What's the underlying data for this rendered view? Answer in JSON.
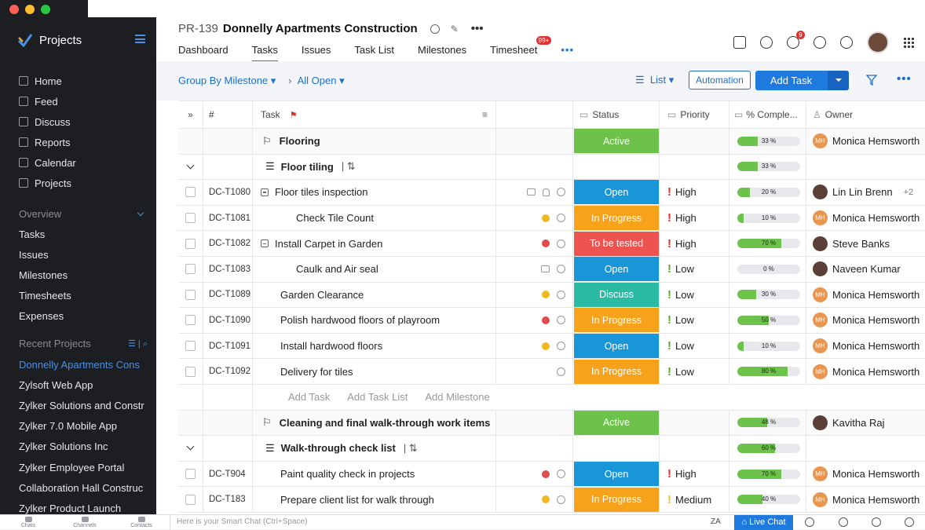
{
  "sidebar": {
    "app_title": "Projects",
    "nav": [
      {
        "label": "Home",
        "icon": "home-icon"
      },
      {
        "label": "Feed",
        "icon": "feed-icon"
      },
      {
        "label": "Discuss",
        "icon": "discuss-icon"
      },
      {
        "label": "Reports",
        "icon": "reports-icon"
      },
      {
        "label": "Calendar",
        "icon": "calendar-icon"
      },
      {
        "label": "Projects",
        "icon": "projects-icon"
      }
    ],
    "overview_label": "Overview",
    "overview_items": [
      "Tasks",
      "Issues",
      "Milestones",
      "Timesheets",
      "Expenses"
    ],
    "recent_label": "Recent Projects",
    "recent_items": [
      "Donnelly Apartments Cons",
      "Zylsoft Web App",
      "Zylker Solutions and Constr",
      "Zylker 7.0 Mobile App",
      "Zylker Solutions Inc",
      "Zylker Employee Portal",
      "Collaboration Hall Construc",
      "Zylker Product Launch"
    ]
  },
  "header": {
    "project_id": "PR-139",
    "project_name": "Donnelly Apartments Construction",
    "tabs": [
      "Dashboard",
      "Tasks",
      "Issues",
      "Task List",
      "Milestones",
      "Timesheet"
    ],
    "timesheet_badge": "99+",
    "notif_badge": "9",
    "more": "•••"
  },
  "toolbar": {
    "group_by": "Group By Milestone",
    "filter": "All Open",
    "view": "List",
    "automation": "Automation",
    "add_task": "Add Task"
  },
  "table": {
    "headers": {
      "id": "#",
      "task": "Task",
      "status": "Status",
      "priority": "Priority",
      "completion": "% Comple...",
      "owner": "Owner"
    },
    "rows": [
      {
        "kind": "milestone",
        "task": "Flooring",
        "status": "Active",
        "status_color": "#6cc24a",
        "pct": 33,
        "pct_label": "33 %",
        "owner": "Monica Hemsworth",
        "owner_initials": "MH"
      },
      {
        "kind": "tasklist",
        "task": "Floor tiling",
        "pct": 33,
        "pct_label": "33 %"
      },
      {
        "kind": "task",
        "id": "DC-T1080",
        "task": "Floor tiles inspection",
        "status": "Open",
        "status_color": "#1896d8",
        "priority": "High",
        "prio_color": "#d9302c",
        "pct": 20,
        "pct_label": "20 %",
        "owner": "Lin Lin Brenn",
        "extra": "+2"
      },
      {
        "kind": "task",
        "id": "DC-T1081",
        "task": "Check Tile Count",
        "status": "In Progress",
        "status_color": "#f7a21b",
        "priority": "High",
        "prio_color": "#d9302c",
        "pct": 10,
        "pct_label": "10 %",
        "owner": "Monica Hemsworth",
        "owner_initials": "MH"
      },
      {
        "kind": "task",
        "id": "DC-T1082",
        "task": "Install Carpet in Garden",
        "status": "To be tested",
        "status_color": "#ef5350",
        "priority": "High",
        "prio_color": "#d9302c",
        "pct": 70,
        "pct_label": "70 %",
        "owner": "Steve Banks"
      },
      {
        "kind": "task",
        "id": "DC-T1083",
        "task": "Caulk and Air seal",
        "status": "Open",
        "status_color": "#1896d8",
        "priority": "Low",
        "prio_color": "#5aa832",
        "pct": 0,
        "pct_label": "0 %",
        "owner": "Naveen Kumar"
      },
      {
        "kind": "task",
        "id": "DC-T1089",
        "task": "Garden Clearance",
        "status": "Discuss",
        "status_color": "#2bbba5",
        "priority": "Low",
        "prio_color": "#5aa832",
        "pct": 30,
        "pct_label": "30 %",
        "owner": "Monica Hemsworth",
        "owner_initials": "MH"
      },
      {
        "kind": "task",
        "id": "DC-T1090",
        "task": "Polish hardwood floors of playroom",
        "status": "In Progress",
        "status_color": "#f7a21b",
        "priority": "Low",
        "prio_color": "#5aa832",
        "pct": 50,
        "pct_label": "50 %",
        "owner": "Monica Hemsworth",
        "owner_initials": "MH"
      },
      {
        "kind": "task",
        "id": "DC-T1091",
        "task": "Install hardwood floors",
        "status": "Open",
        "status_color": "#1896d8",
        "priority": "Low",
        "prio_color": "#5aa832",
        "pct": 10,
        "pct_label": "10 %",
        "owner": "Monica Hemsworth",
        "owner_initials": "MH"
      },
      {
        "kind": "task",
        "id": "DC-T1092",
        "task": "Delivery for tiles",
        "status": "In Progress",
        "status_color": "#f7a21b",
        "priority": "Low",
        "prio_color": "#5aa832",
        "pct": 80,
        "pct_label": "80 %",
        "owner": "Monica Hemsworth",
        "owner_initials": "MH"
      },
      {
        "kind": "links",
        "links": [
          "Add Task",
          "Add Task List",
          "Add Milestone"
        ]
      },
      {
        "kind": "milestone",
        "task": "Cleaning and final walk-through work items",
        "status": "Active",
        "status_color": "#6cc24a",
        "pct": 48,
        "pct_label": "48 %",
        "owner": "Kavitha Raj"
      },
      {
        "kind": "tasklist",
        "task": "Walk-through check list",
        "pct": 60,
        "pct_label": "60 %"
      },
      {
        "kind": "task",
        "id": "DC-T904",
        "task": "Paint quality check in projects",
        "status": "Open",
        "status_color": "#1896d8",
        "priority": "High",
        "prio_color": "#d9302c",
        "pct": 70,
        "pct_label": "70 %",
        "owner": "Monica Hemsworth",
        "owner_initials": "MH"
      },
      {
        "kind": "task",
        "id": "DC-T183",
        "task": "Prepare client list for walk through",
        "status": "In Progress",
        "status_color": "#f7a21b",
        "priority": "Medium",
        "prio_color": "#f2b824",
        "pct": 40,
        "pct_label": "40 %",
        "owner": "Monica Hemsworth",
        "owner_initials": "MH"
      }
    ]
  },
  "bottombar": {
    "chats": "Chats",
    "channels": "Channels",
    "contacts": "Contacts",
    "smart_chat": "Here is your Smart Chat (Ctrl+Space)",
    "live_chat": "Live Chat"
  },
  "colors": {
    "accent": "#1f7ae0",
    "sidebar_bg": "#1d1e22"
  }
}
